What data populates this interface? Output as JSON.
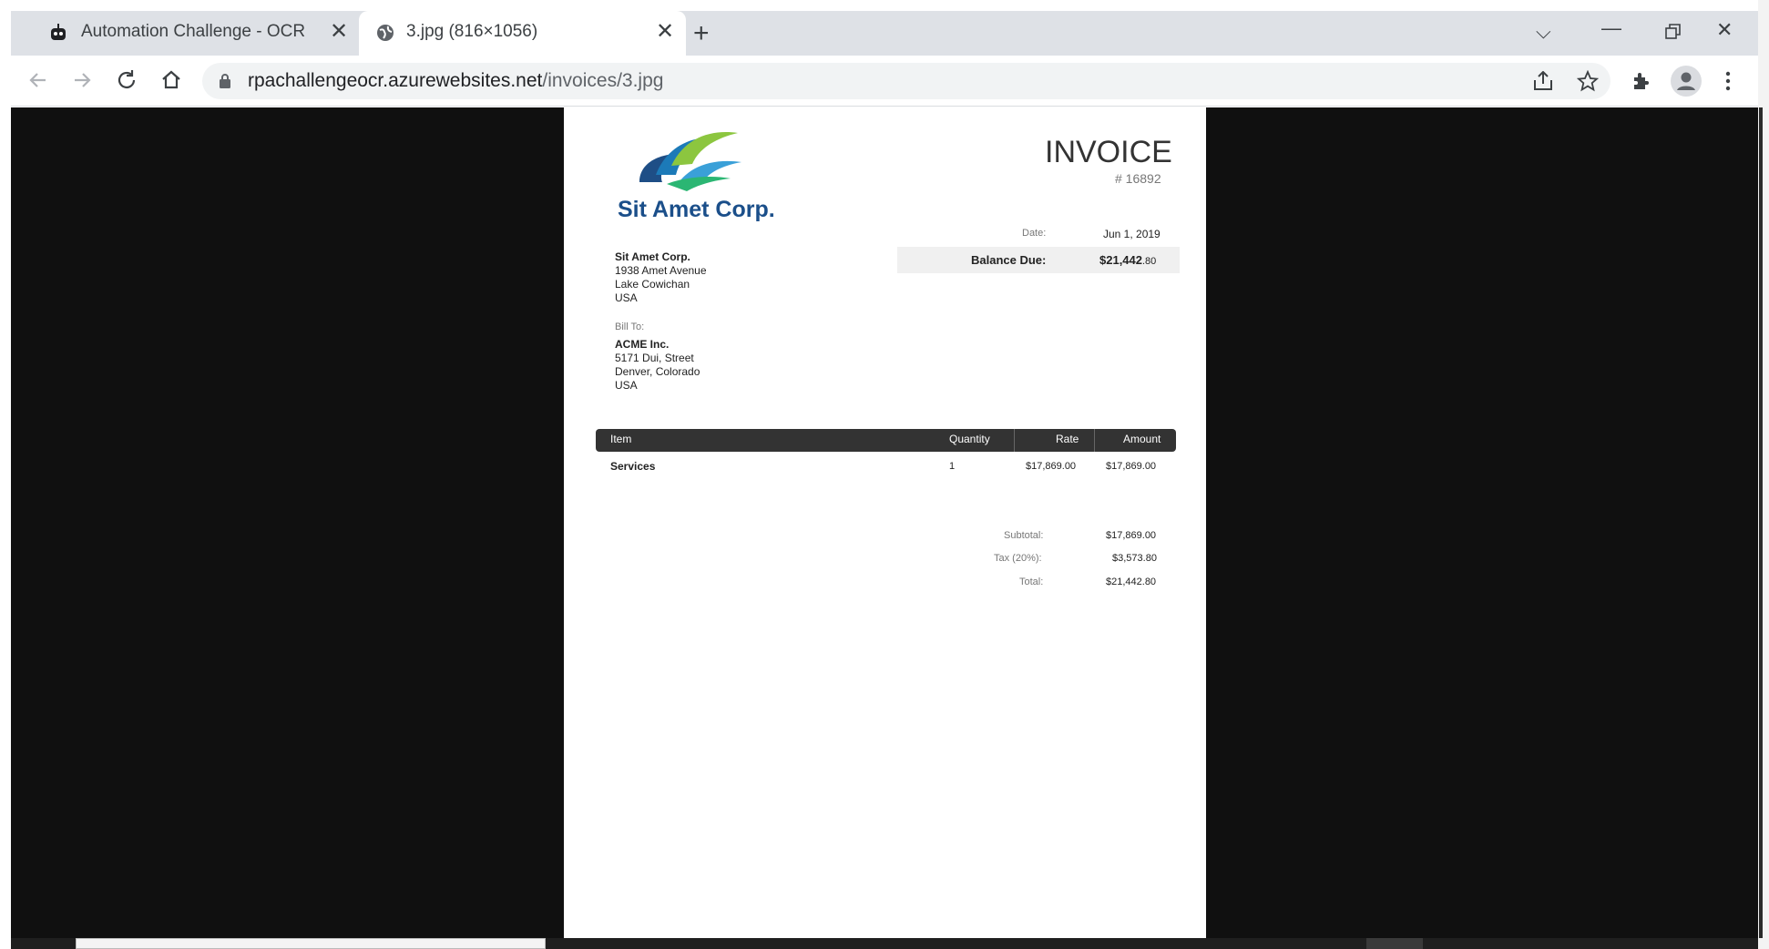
{
  "browser": {
    "tabs": [
      {
        "title": "Automation Challenge - OCR",
        "icon": "robot-icon",
        "active": false
      },
      {
        "title": "3.jpg (816×1056)",
        "icon": "globe-icon",
        "active": true
      }
    ],
    "new_tab_icon": "plus-icon",
    "url_domain": "rpachallengeocr.azurewebsites.net",
    "url_path": "/invoices/3.jpg"
  },
  "invoice": {
    "company_logo_text": "Sit Amet Corp.",
    "title": "INVOICE",
    "number": "# 16892",
    "date_label": "Date:",
    "date_value": "Jun 1, 2019",
    "balance_label": "Balance Due:",
    "balance_main": "$21,442",
    "balance_cents": ".80",
    "from": {
      "name": "Sit Amet Corp.",
      "line1": "1938 Amet Avenue",
      "line2": "Lake Cowichan",
      "line3": "USA"
    },
    "bill_to_label": "Bill To:",
    "bill_to": {
      "name": "ACME Inc.",
      "line1": "5171 Dui, Street",
      "line2": "Denver, Colorado",
      "line3": "USA"
    },
    "table": {
      "headers": {
        "item": "Item",
        "quantity": "Quantity",
        "rate": "Rate",
        "amount": "Amount"
      },
      "rows": [
        {
          "item": "Services",
          "quantity": "1",
          "rate": "$17,869.00",
          "amount": "$17,869.00"
        }
      ]
    },
    "totals": {
      "subtotal_label": "Subtotal:",
      "subtotal_value": "$17,869.00",
      "tax_label": "Tax (20%):",
      "tax_value": "$3,573.80",
      "total_label": "Total:",
      "total_value": "$21,442.80"
    }
  }
}
